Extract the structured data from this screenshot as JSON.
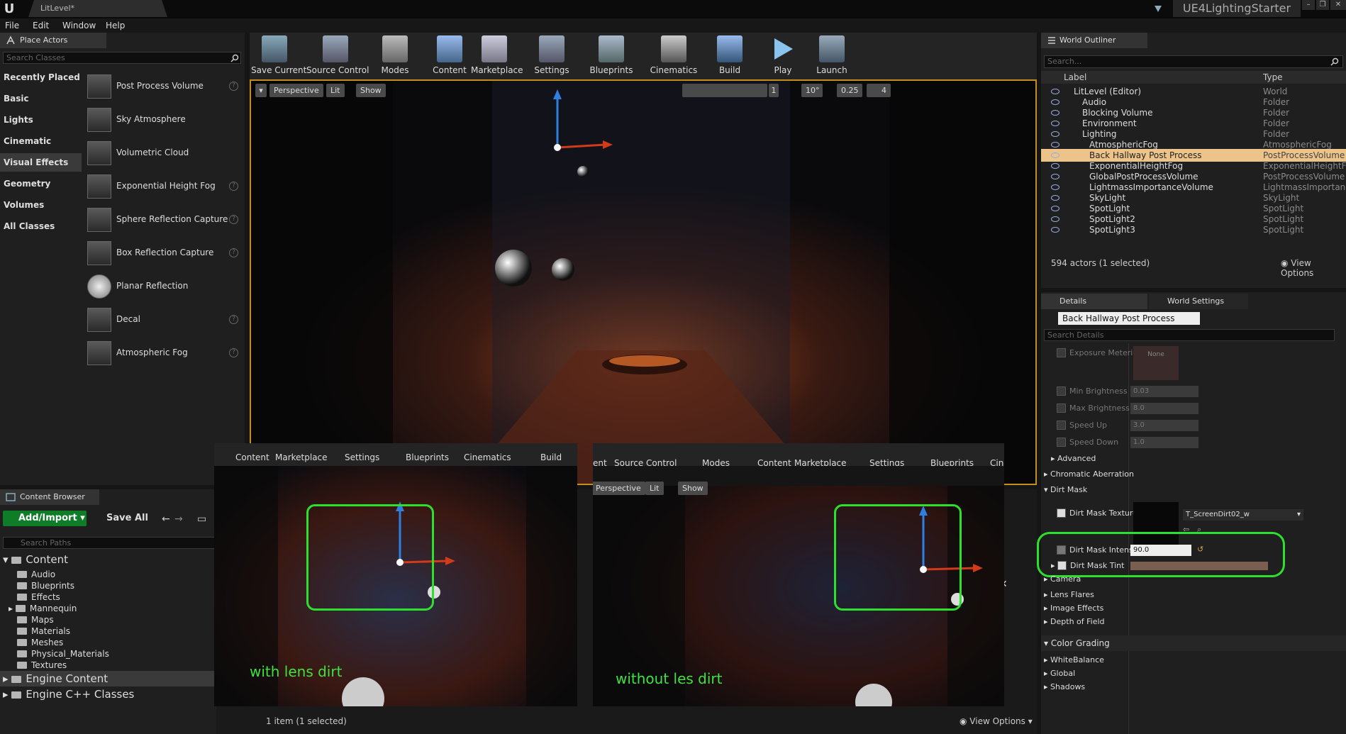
{
  "title": {
    "tab": "LitLevel*",
    "project": "UE4LightingStarter"
  },
  "menu": [
    "File",
    "Edit",
    "Window",
    "Help"
  ],
  "place_actors": {
    "tab": "Place Actors",
    "search_placeholder": "Search Classes",
    "categories": [
      "Recently Placed",
      "Basic",
      "Lights",
      "Cinematic",
      "Visual Effects",
      "Geometry",
      "Volumes",
      "All Classes"
    ],
    "selected_category": "Visual Effects",
    "items": [
      "Post Process Volume",
      "Sky Atmosphere",
      "Volumetric Cloud",
      "Exponential Height Fog",
      "Sphere Reflection Capture",
      "Box Reflection Capture",
      "Planar Reflection",
      "Decal",
      "Atmospheric Fog"
    ]
  },
  "toolbar": [
    "Save Current",
    "Source Control",
    "Modes",
    "Content",
    "Marketplace",
    "Settings",
    "Blueprints",
    "Cinematics",
    "Build",
    "Play",
    "Launch"
  ],
  "viewport": {
    "perspective": "Perspective",
    "lit": "Lit",
    "show": "Show",
    "snap_angle": "10°",
    "scale": "0.25",
    "camera_speed": "4",
    "layer": "1"
  },
  "content_browser": {
    "tab": "Content Browser",
    "add_import": "Add/Import",
    "save_all": "Save All",
    "search_placeholder": "Search Paths",
    "root": "Content",
    "folders": [
      "Audio",
      "Blueprints",
      "Effects",
      "Mannequin",
      "Maps",
      "Materials",
      "Meshes",
      "Physical_Materials",
      "Textures"
    ],
    "engine_content": "Engine Content",
    "engine_cpp": "Engine C++ Classes",
    "status": "1 item (1 selected)",
    "view_options": "View Options"
  },
  "insets": {
    "left": {
      "toolbar": [
        "Content",
        "Marketplace",
        "Settings",
        "Blueprints",
        "Cinematics",
        "Build"
      ],
      "label": "with lens dirt"
    },
    "right": {
      "toolbar": [
        "ent",
        "Source Control",
        "Modes",
        "Content",
        "Marketplace",
        "Settings",
        "Blueprints",
        "Ciner"
      ],
      "perspective": "Perspective",
      "lit": "Lit",
      "show": "Show",
      "label": "without les dirt"
    }
  },
  "outliner": {
    "tab": "World Outliner",
    "search_placeholder": "Search...",
    "col_label": "Label",
    "col_type": "Type",
    "rows": [
      {
        "label": "LitLevel (Editor)",
        "type": "World"
      },
      {
        "label": "Audio",
        "type": "Folder"
      },
      {
        "label": "Blocking Volume",
        "type": "Folder"
      },
      {
        "label": "Environment",
        "type": "Folder"
      },
      {
        "label": "Lighting",
        "type": "Folder"
      },
      {
        "label": "AtmosphericFog",
        "type": "AtmosphericFog"
      },
      {
        "label": "Back Hallway Post Process",
        "type": "PostProcessVolume"
      },
      {
        "label": "ExponentialHeightFog",
        "type": "ExponentialHeightFo"
      },
      {
        "label": "GlobalPostProcessVolume",
        "type": "PostProcessVolume"
      },
      {
        "label": "LightmassImportanceVolume",
        "type": "LightmassImportance"
      },
      {
        "label": "SkyLight",
        "type": "SkyLight"
      },
      {
        "label": "SpotLight",
        "type": "SpotLight"
      },
      {
        "label": "SpotLight2",
        "type": "SpotLight"
      },
      {
        "label": "SpotLight3",
        "type": "SpotLight"
      }
    ],
    "status": "594 actors (1 selected)",
    "view_options": "View Options"
  },
  "details": {
    "tab": "Details",
    "tab2": "World Settings",
    "actor_name": "Back Hallway Post Process",
    "search_placeholder": "Search Details",
    "exposure_metering": "Exposure Metering M",
    "exposure_none": "None",
    "min_brightness": {
      "label": "Min Brightness",
      "value": "0.03"
    },
    "max_brightness": {
      "label": "Max Brightness",
      "value": "8.0"
    },
    "speed_up": {
      "label": "Speed Up",
      "value": "3.0"
    },
    "speed_down": {
      "label": "Speed Down",
      "value": "1.0"
    },
    "advanced": "Advanced",
    "chromatic_aberration": "Chromatic Aberration",
    "dirt_mask": "Dirt Mask",
    "dirt_mask_texture": {
      "label": "Dirt Mask Texture",
      "value": "T_ScreenDirt02_w"
    },
    "dirt_mask_intensity": {
      "label": "Dirt Mask Intensity",
      "value": "90.0"
    },
    "dirt_mask_tint": "Dirt Mask Tint",
    "camera": "Camera",
    "sections": [
      "Lens Flares",
      "Image Effects",
      "Depth of Field"
    ],
    "color_grading": "Color Grading",
    "cg_sections": [
      "WhiteBalance",
      "Global",
      "Shadows"
    ]
  }
}
